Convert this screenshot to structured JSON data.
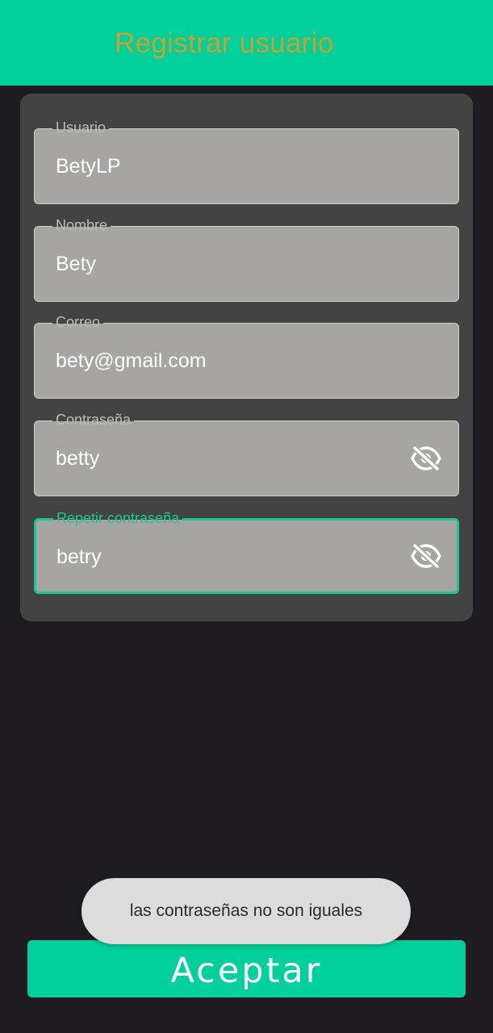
{
  "header": {
    "title": "Registrar usuario"
  },
  "form": {
    "fields": [
      {
        "label": "Usuario",
        "value": "BetyLP"
      },
      {
        "label": "Nombre",
        "value": "Bety"
      },
      {
        "label": "Correo",
        "value": "bety@gmail.com"
      },
      {
        "label": "Contraseña",
        "value": "betty",
        "icon": "eye-off-icon"
      },
      {
        "label": "Repetir contraseña",
        "value": "betry",
        "icon": "eye-off-icon",
        "focused": true
      }
    ]
  },
  "toast": {
    "message": "las contraseñas no son iguales"
  },
  "actions": {
    "accept_label": "Aceptar"
  },
  "colors": {
    "primary": "#00d09b",
    "title_text": "#c9a12c",
    "background": "#1e1c21",
    "card": "#434343",
    "field_fill": "#a6a5a1",
    "focus_accent": "#1bc993",
    "toast_bg": "#dcdcdc"
  }
}
